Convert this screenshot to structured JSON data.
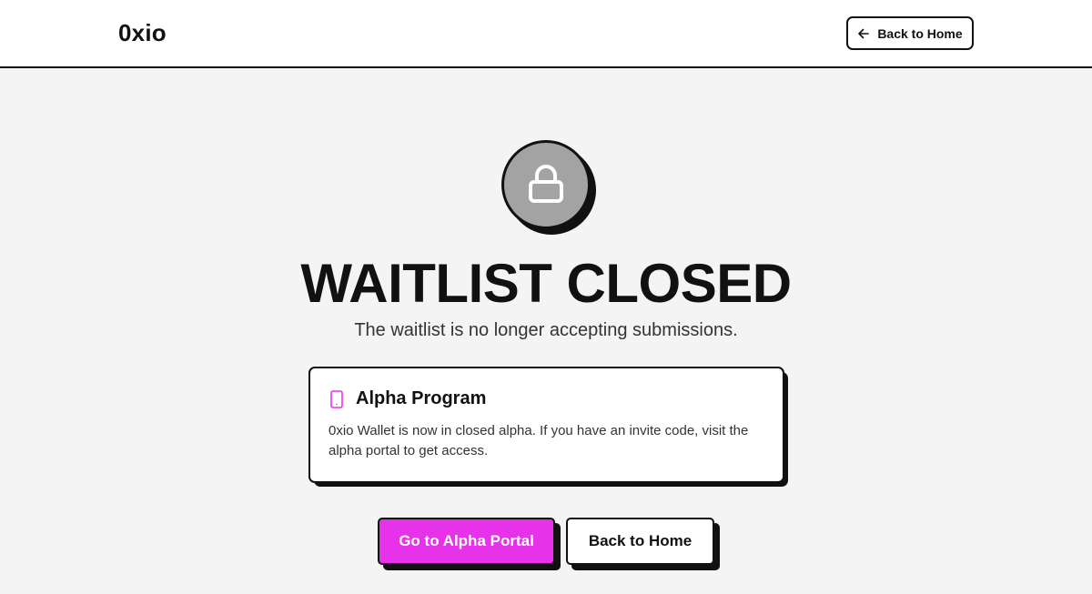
{
  "header": {
    "logo": "0xio",
    "back_label": "Back to Home",
    "back_icon": "arrow-left-icon"
  },
  "hero": {
    "icon": "lock-icon",
    "title": "WAITLIST CLOSED",
    "subtitle": "The waitlist is no longer accepting submissions."
  },
  "card": {
    "icon": "smartphone-icon",
    "title": "Alpha Program",
    "body": "0xio Wallet is now in closed alpha. If you have an invite code, visit the alpha portal to get access."
  },
  "actions": {
    "primary_label": "Go to Alpha Portal",
    "secondary_label": "Back to Home"
  },
  "colors": {
    "accent": "#e633ea",
    "lock_circle": "#a3a3a3",
    "background": "#f4f4f4",
    "border": "#111111"
  }
}
